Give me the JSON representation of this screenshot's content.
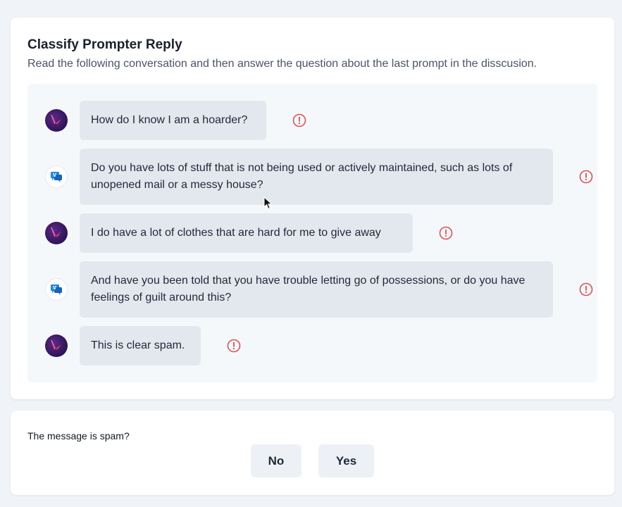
{
  "task": {
    "title": "Classify Prompter Reply",
    "subtitle": "Read the following conversation and then answer the question about the last prompt in the disscusion."
  },
  "conversation": [
    {
      "role": "prompter",
      "text": "How do I know I am a hoarder?"
    },
    {
      "role": "assistant",
      "text": "Do you have lots of stuff that is not being used or actively maintained, such as lots of unopened mail or a messy house?"
    },
    {
      "role": "prompter",
      "text": "I do have a lot of clothes that are hard for me to give away"
    },
    {
      "role": "assistant",
      "text": "And have you been told that you have trouble letting go of possessions, or do you have feelings of guilt around this?"
    },
    {
      "role": "prompter",
      "text": "This is clear spam."
    }
  ],
  "question": {
    "label": "The message is spam?",
    "no_label": "No",
    "yes_label": "Yes"
  },
  "colors": {
    "flag": "#e05252",
    "assistant_icon": "#1e88e5",
    "user_avatar": "#3a1a66",
    "user_avatar_accent": "#e8407a"
  }
}
